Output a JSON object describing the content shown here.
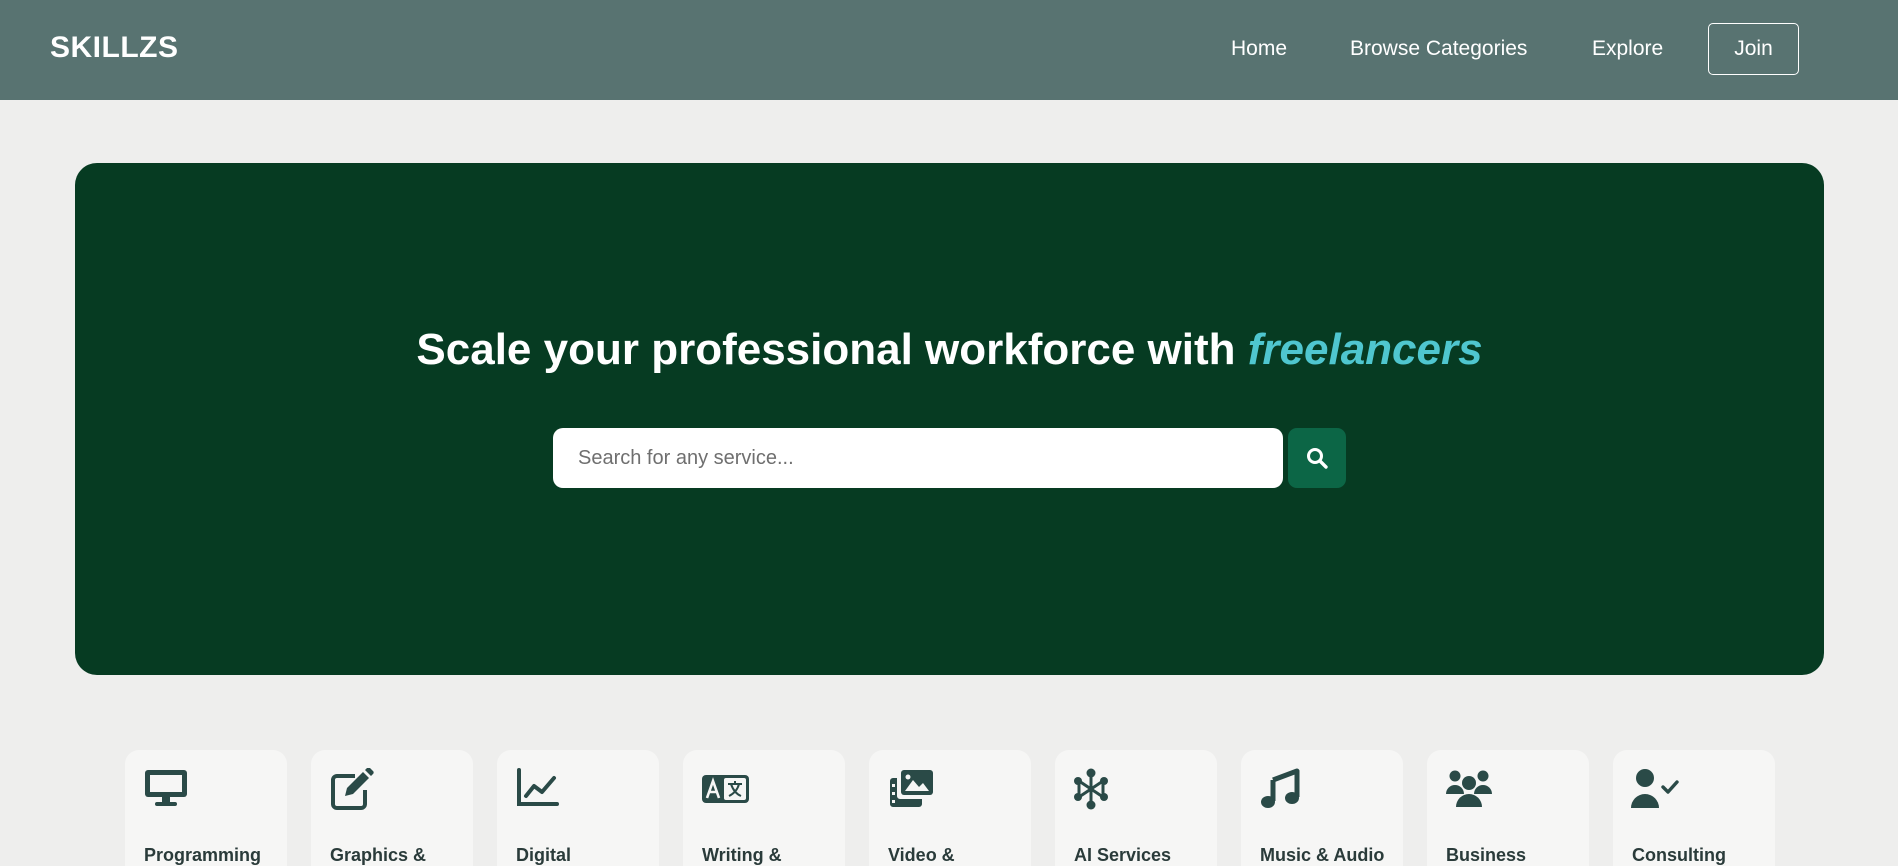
{
  "nav": {
    "brand": "SKILLZS",
    "links": [
      "Home",
      "Browse Categories",
      "Explore"
    ],
    "join_label": "Join"
  },
  "hero": {
    "title_main": "Scale your professional workforce with ",
    "title_accent": "freelancers",
    "search_placeholder": "Search for any service..."
  },
  "categories": [
    {
      "label": "Programming",
      "icon": "monitor-icon"
    },
    {
      "label": "Graphics &",
      "icon": "pen-square-icon"
    },
    {
      "label": "Digital",
      "icon": "line-chart-icon"
    },
    {
      "label": "Writing &",
      "icon": "translate-icon"
    },
    {
      "label": "Video &",
      "icon": "photo-film-icon"
    },
    {
      "label": "AI Services",
      "icon": "circle-nodes-icon"
    },
    {
      "label": "Music & Audio",
      "icon": "music-icon"
    },
    {
      "label": "Business",
      "icon": "users-icon"
    },
    {
      "label": "Consulting",
      "icon": "user-check-icon"
    }
  ],
  "colors": {
    "navbar": "#587371",
    "hero": "#063b22",
    "accent": "#4fc6cf",
    "search_button": "#0c6646",
    "icon": "#2a4a47"
  }
}
